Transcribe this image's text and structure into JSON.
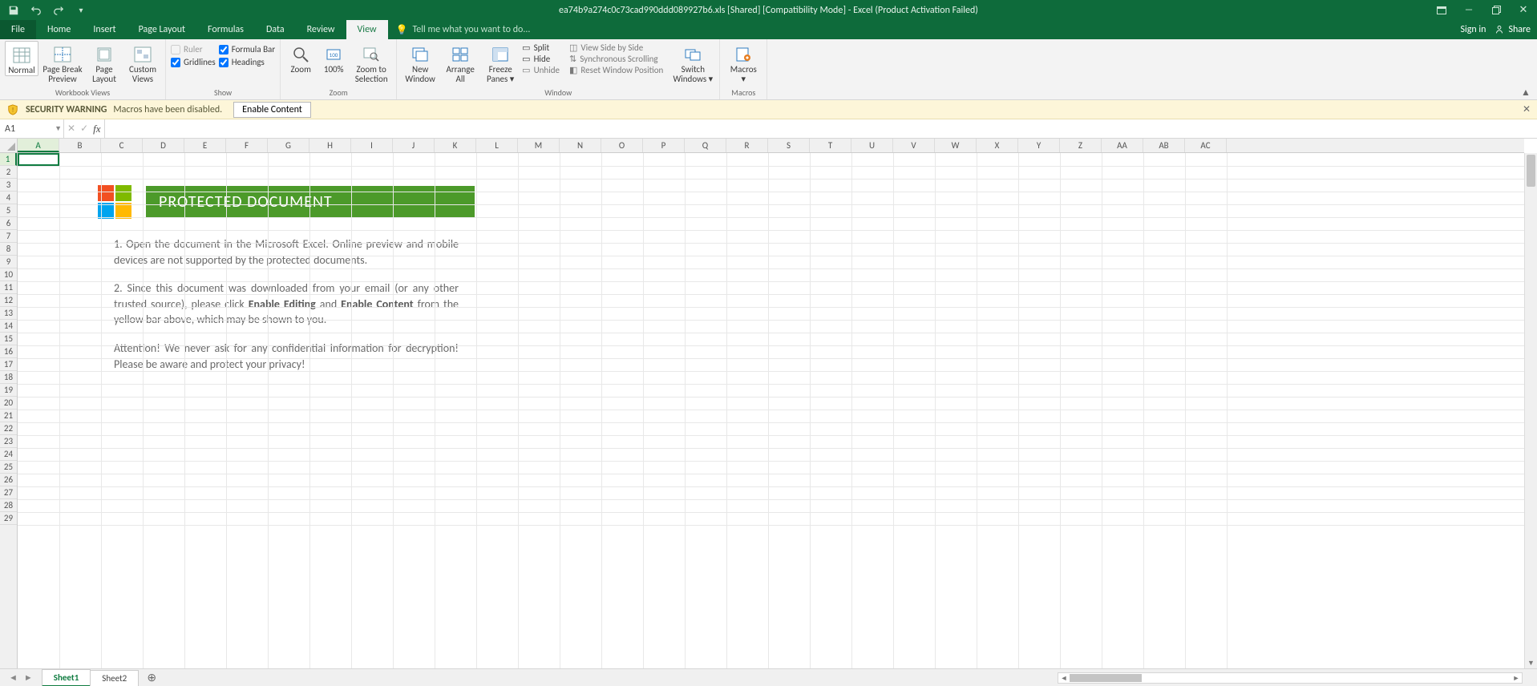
{
  "titlebar": {
    "title": "ea74b9a274c0c73cad990ddd089927b6.xls  [Shared]  [Compatibility Mode] - Excel (Product Activation Failed)"
  },
  "tabs": {
    "file": "File",
    "items": [
      "Home",
      "Insert",
      "Page Layout",
      "Formulas",
      "Data",
      "Review",
      "View"
    ],
    "active": "View",
    "tellme": "Tell me what you want to do...",
    "signin": "Sign in",
    "share": "Share"
  },
  "ribbon": {
    "wbviews": {
      "normal": "Normal",
      "pgbreak1": "Page Break",
      "pgbreak2": "Preview",
      "pglayout1": "Page",
      "pglayout2": "Layout",
      "custom1": "Custom",
      "custom2": "Views",
      "label": "Workbook Views"
    },
    "show": {
      "ruler": "Ruler",
      "formula": "Formula Bar",
      "gridlines": "Gridlines",
      "headings": "Headings",
      "label": "Show"
    },
    "zoom": {
      "zoom": "Zoom",
      "z100": "100%",
      "zsel1": "Zoom to",
      "zsel2": "Selection",
      "label": "Zoom"
    },
    "window": {
      "neww1": "New",
      "neww2": "Window",
      "arrange1": "Arrange",
      "arrange2": "All",
      "freeze1": "Freeze",
      "freeze2": "Panes",
      "split": "Split",
      "hide": "Hide",
      "unhide": "Unhide",
      "sidebyside": "View Side by Side",
      "sync": "Synchronous Scrolling",
      "reset": "Reset Window Position",
      "switch1": "Switch",
      "switch2": "Windows",
      "label": "Window"
    },
    "macros": {
      "macros": "Macros",
      "label": "Macros"
    }
  },
  "secbar": {
    "title": "SECURITY WARNING",
    "msg": "Macros have been disabled.",
    "button": "Enable Content"
  },
  "namebox": "A1",
  "columns": [
    "A",
    "B",
    "C",
    "D",
    "E",
    "F",
    "G",
    "H",
    "I",
    "J",
    "K",
    "L",
    "M",
    "N",
    "O",
    "P",
    "Q",
    "R",
    "S",
    "T",
    "U",
    "V",
    "W",
    "X",
    "Y",
    "Z",
    "AA",
    "AB",
    "AC"
  ],
  "rows": 29,
  "overlay": {
    "banner": "PROTECTED DOCUMENT",
    "p1": "1. Open the document in the Microsoft Excel. Online preview and mobile devices are not supported by the protected documents.",
    "p2a": "2. Since this document was downloaded from your email (or any other trusted source), please click ",
    "p2b_bold1": "Enable Editing",
    "p2c": " and ",
    "p2d_bold2": "Enable Content",
    "p2e": " from the yellow bar above, which may be shown to you.",
    "p3": "Attention! We never ask for any confidential information for decryption! Please be aware and protect your privacy!"
  },
  "sheets": {
    "s1": "Sheet1",
    "s2": "Sheet2"
  }
}
